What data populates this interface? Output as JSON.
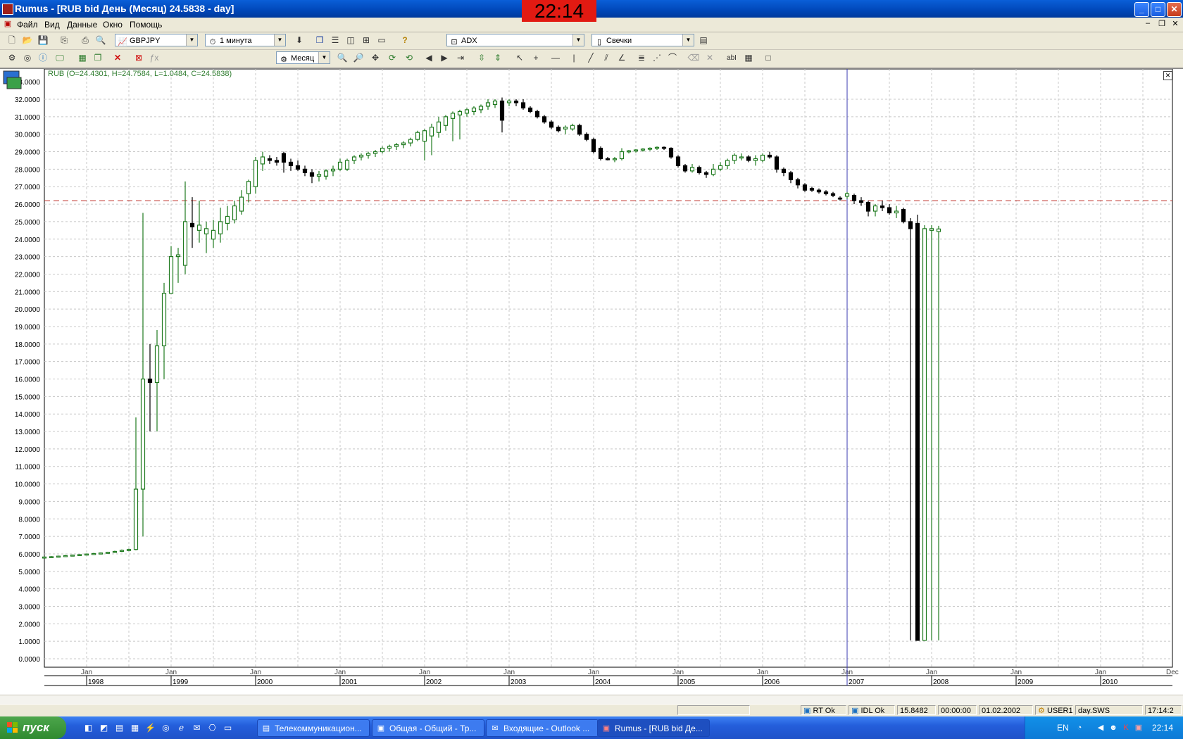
{
  "window": {
    "title": "Rumus - [RUB bid День (Месяц) 24.5838 - day]",
    "clock": "22:14",
    "buttons": {
      "minimize": "_",
      "maximize": "□",
      "close": "✕"
    }
  },
  "menu": {
    "items": [
      "Файл",
      "Вид",
      "Данные",
      "Окно",
      "Помощь"
    ],
    "mdi_buttons": [
      "–",
      "❐",
      "✕"
    ]
  },
  "toolbar1": {
    "symbol_combo": "GBPJPY",
    "interval_combo": "1 минута",
    "indicator_combo": "ADX",
    "chart_type_combo": "Свечки"
  },
  "toolbar2": {
    "period_combo": "Месяц",
    "text_tool": "abI"
  },
  "chart": {
    "ohlc_label": "RUB (O=24.4301, H=24.7584, L=1.0484, C=24.5838)",
    "colors": {
      "up": "#1f7a1f",
      "down": "#000000",
      "grid": "#c8c8c8",
      "hline": "#c0302a",
      "vline": "#3a3ab0"
    },
    "y_labels": [
      "32.0000",
      "31.0000",
      "30.0000",
      "29.0000",
      "28.0000",
      "27.0000",
      "26.0000",
      "25.0000",
      "24.0000",
      "23.0000",
      "22.0000",
      "21.0000",
      "20.0000",
      "19.0000",
      "18.0000",
      "17.0000",
      "16.0000",
      "15.0000",
      "14.0000",
      "13.0000",
      "12.0000",
      "11.0000",
      "10.0000",
      "9.0000",
      "8.0000",
      "7.0000",
      "6.0000",
      "5.0000",
      "4.0000",
      "3.0000",
      "2.0000",
      "1.0000",
      "0.0000"
    ],
    "y_top_label": "33.0000",
    "x_month_label": "Jan",
    "x_years": [
      "1998",
      "1999",
      "2000",
      "2001",
      "2002",
      "2003",
      "2004",
      "2005",
      "2006",
      "2007",
      "2008",
      "2009",
      "2010"
    ],
    "x_end_label": "Dec"
  },
  "chart_data": {
    "type": "candlestick",
    "title": "RUB bid День (Месяц)",
    "ylim": [
      0,
      33
    ],
    "x_range": [
      "1997-07",
      "2011-01"
    ],
    "hline": 26.2,
    "vline": "2007-01",
    "series": [
      {
        "t": "1997-07",
        "o": 5.8,
        "h": 5.85,
        "l": 5.75,
        "c": 5.82
      },
      {
        "t": "1997-08",
        "o": 5.82,
        "h": 5.87,
        "l": 5.78,
        "c": 5.84
      },
      {
        "t": "1997-09",
        "o": 5.84,
        "h": 5.9,
        "l": 5.8,
        "c": 5.87
      },
      {
        "t": "1997-10",
        "o": 5.87,
        "h": 5.93,
        "l": 5.83,
        "c": 5.9
      },
      {
        "t": "1997-11",
        "o": 5.9,
        "h": 5.96,
        "l": 5.86,
        "c": 5.93
      },
      {
        "t": "1997-12",
        "o": 5.93,
        "h": 5.99,
        "l": 5.89,
        "c": 5.96
      },
      {
        "t": "1998-01",
        "o": 5.96,
        "h": 6.02,
        "l": 5.92,
        "c": 5.99
      },
      {
        "t": "1998-02",
        "o": 5.99,
        "h": 6.05,
        "l": 5.95,
        "c": 6.02
      },
      {
        "t": "1998-03",
        "o": 6.02,
        "h": 6.08,
        "l": 5.98,
        "c": 6.05
      },
      {
        "t": "1998-04",
        "o": 6.05,
        "h": 6.12,
        "l": 6.01,
        "c": 6.09
      },
      {
        "t": "1998-05",
        "o": 6.09,
        "h": 6.18,
        "l": 6.05,
        "c": 6.14
      },
      {
        "t": "1998-06",
        "o": 6.14,
        "h": 6.25,
        "l": 6.1,
        "c": 6.2
      },
      {
        "t": "1998-07",
        "o": 6.2,
        "h": 6.3,
        "l": 6.15,
        "c": 6.25
      },
      {
        "t": "1998-08",
        "o": 6.25,
        "h": 13.8,
        "l": 6.2,
        "c": 9.7
      },
      {
        "t": "1998-09",
        "o": 9.7,
        "h": 25.5,
        "l": 7.0,
        "c": 16.0
      },
      {
        "t": "1998-10",
        "o": 16.0,
        "h": 18.0,
        "l": 13.0,
        "c": 15.8
      },
      {
        "t": "1998-11",
        "o": 15.8,
        "h": 18.8,
        "l": 13.0,
        "c": 17.9
      },
      {
        "t": "1998-12",
        "o": 17.9,
        "h": 21.5,
        "l": 16.0,
        "c": 20.9
      },
      {
        "t": "1999-01",
        "o": 20.9,
        "h": 23.6,
        "l": 21.0,
        "c": 23.0
      },
      {
        "t": "1999-02",
        "o": 23.0,
        "h": 23.5,
        "l": 21.5,
        "c": 23.1
      },
      {
        "t": "1999-03",
        "o": 22.5,
        "h": 27.3,
        "l": 22.0,
        "c": 25.0
      },
      {
        "t": "1999-04",
        "o": 24.9,
        "h": 26.4,
        "l": 23.5,
        "c": 24.7
      },
      {
        "t": "1999-05",
        "o": 24.5,
        "h": 26.2,
        "l": 23.8,
        "c": 24.8
      },
      {
        "t": "1999-06",
        "o": 24.3,
        "h": 25.0,
        "l": 23.2,
        "c": 24.6
      },
      {
        "t": "1999-07",
        "o": 24.0,
        "h": 25.1,
        "l": 23.5,
        "c": 24.5
      },
      {
        "t": "1999-08",
        "o": 24.3,
        "h": 25.8,
        "l": 23.8,
        "c": 25.0
      },
      {
        "t": "1999-09",
        "o": 24.9,
        "h": 25.9,
        "l": 24.5,
        "c": 25.3
      },
      {
        "t": "1999-10",
        "o": 25.1,
        "h": 26.2,
        "l": 24.9,
        "c": 25.9
      },
      {
        "t": "1999-11",
        "o": 25.6,
        "h": 26.8,
        "l": 25.4,
        "c": 26.4
      },
      {
        "t": "1999-12",
        "o": 26.6,
        "h": 27.4,
        "l": 26.1,
        "c": 27.3
      },
      {
        "t": "2000-01",
        "o": 27.0,
        "h": 28.7,
        "l": 26.6,
        "c": 28.5
      },
      {
        "t": "2000-02",
        "o": 28.3,
        "h": 29.0,
        "l": 27.9,
        "c": 28.7
      },
      {
        "t": "2000-03",
        "o": 28.6,
        "h": 28.8,
        "l": 28.3,
        "c": 28.5
      },
      {
        "t": "2000-04",
        "o": 28.5,
        "h": 28.7,
        "l": 28.2,
        "c": 28.4
      },
      {
        "t": "2000-05",
        "o": 28.9,
        "h": 29.0,
        "l": 27.8,
        "c": 28.4
      },
      {
        "t": "2000-06",
        "o": 28.4,
        "h": 28.6,
        "l": 27.9,
        "c": 28.2
      },
      {
        "t": "2000-07",
        "o": 28.2,
        "h": 28.5,
        "l": 27.9,
        "c": 28.0
      },
      {
        "t": "2000-08",
        "o": 28.0,
        "h": 28.2,
        "l": 27.6,
        "c": 27.8
      },
      {
        "t": "2000-09",
        "o": 27.8,
        "h": 28.0,
        "l": 27.2,
        "c": 27.6
      },
      {
        "t": "2000-10",
        "o": 27.6,
        "h": 27.9,
        "l": 27.3,
        "c": 27.7
      },
      {
        "t": "2000-11",
        "o": 27.6,
        "h": 28.0,
        "l": 27.4,
        "c": 27.9
      },
      {
        "t": "2000-12",
        "o": 27.9,
        "h": 28.2,
        "l": 27.6,
        "c": 28.0
      },
      {
        "t": "2001-01",
        "o": 28.0,
        "h": 28.6,
        "l": 27.9,
        "c": 28.4
      },
      {
        "t": "2001-02",
        "o": 28.0,
        "h": 28.6,
        "l": 27.9,
        "c": 28.5
      },
      {
        "t": "2001-03",
        "o": 28.5,
        "h": 28.8,
        "l": 28.3,
        "c": 28.7
      },
      {
        "t": "2001-04",
        "o": 28.7,
        "h": 28.9,
        "l": 28.5,
        "c": 28.8
      },
      {
        "t": "2001-05",
        "o": 28.8,
        "h": 29.0,
        "l": 28.6,
        "c": 28.9
      },
      {
        "t": "2001-06",
        "o": 28.9,
        "h": 29.1,
        "l": 28.7,
        "c": 29.0
      },
      {
        "t": "2001-07",
        "o": 29.0,
        "h": 29.3,
        "l": 28.9,
        "c": 29.2
      },
      {
        "t": "2001-08",
        "o": 29.2,
        "h": 29.4,
        "l": 29.0,
        "c": 29.3
      },
      {
        "t": "2001-09",
        "o": 29.3,
        "h": 29.5,
        "l": 29.1,
        "c": 29.4
      },
      {
        "t": "2001-10",
        "o": 29.4,
        "h": 29.6,
        "l": 29.2,
        "c": 29.5
      },
      {
        "t": "2001-11",
        "o": 29.5,
        "h": 29.8,
        "l": 29.3,
        "c": 29.7
      },
      {
        "t": "2001-12",
        "o": 29.7,
        "h": 30.2,
        "l": 29.6,
        "c": 30.1
      },
      {
        "t": "2002-01",
        "o": 29.6,
        "h": 30.3,
        "l": 28.5,
        "c": 30.2
      },
      {
        "t": "2002-02",
        "o": 29.9,
        "h": 30.6,
        "l": 28.8,
        "c": 30.4
      },
      {
        "t": "2002-03",
        "o": 30.1,
        "h": 31.0,
        "l": 29.8,
        "c": 30.7
      },
      {
        "t": "2002-04",
        "o": 30.5,
        "h": 31.1,
        "l": 30.2,
        "c": 31.0
      },
      {
        "t": "2002-05",
        "o": 30.9,
        "h": 31.3,
        "l": 29.6,
        "c": 31.2
      },
      {
        "t": "2002-06",
        "o": 31.1,
        "h": 31.4,
        "l": 29.7,
        "c": 31.3
      },
      {
        "t": "2002-07",
        "o": 31.2,
        "h": 31.5,
        "l": 31.0,
        "c": 31.4
      },
      {
        "t": "2002-08",
        "o": 31.3,
        "h": 31.6,
        "l": 31.1,
        "c": 31.5
      },
      {
        "t": "2002-09",
        "o": 31.4,
        "h": 31.7,
        "l": 31.2,
        "c": 31.6
      },
      {
        "t": "2002-10",
        "o": 31.6,
        "h": 32.0,
        "l": 31.4,
        "c": 31.8
      },
      {
        "t": "2002-11",
        "o": 31.7,
        "h": 32.0,
        "l": 31.5,
        "c": 31.9
      },
      {
        "t": "2002-12",
        "o": 31.9,
        "h": 32.1,
        "l": 30.1,
        "c": 30.8
      },
      {
        "t": "2003-01",
        "o": 31.8,
        "h": 32.0,
        "l": 31.6,
        "c": 31.9
      },
      {
        "t": "2003-02",
        "o": 31.9,
        "h": 32.0,
        "l": 31.6,
        "c": 31.8
      },
      {
        "t": "2003-03",
        "o": 31.8,
        "h": 32.0,
        "l": 31.4,
        "c": 31.5
      },
      {
        "t": "2003-04",
        "o": 31.5,
        "h": 31.6,
        "l": 31.2,
        "c": 31.3
      },
      {
        "t": "2003-05",
        "o": 31.3,
        "h": 31.4,
        "l": 30.9,
        "c": 31.0
      },
      {
        "t": "2003-06",
        "o": 31.0,
        "h": 31.1,
        "l": 30.6,
        "c": 30.7
      },
      {
        "t": "2003-07",
        "o": 30.7,
        "h": 30.8,
        "l": 30.3,
        "c": 30.4
      },
      {
        "t": "2003-08",
        "o": 30.4,
        "h": 30.5,
        "l": 30.1,
        "c": 30.2
      },
      {
        "t": "2003-09",
        "o": 30.3,
        "h": 30.5,
        "l": 30.0,
        "c": 30.4
      },
      {
        "t": "2003-10",
        "o": 30.3,
        "h": 30.6,
        "l": 30.2,
        "c": 30.5
      },
      {
        "t": "2003-11",
        "o": 30.5,
        "h": 30.6,
        "l": 29.9,
        "c": 30.0
      },
      {
        "t": "2003-12",
        "o": 30.0,
        "h": 30.1,
        "l": 29.6,
        "c": 29.7
      },
      {
        "t": "2004-01",
        "o": 29.7,
        "h": 29.8,
        "l": 28.9,
        "c": 29.0
      },
      {
        "t": "2004-02",
        "o": 29.2,
        "h": 29.3,
        "l": 28.5,
        "c": 28.6
      },
      {
        "t": "2004-03",
        "o": 28.6,
        "h": 28.7,
        "l": 28.5,
        "c": 28.55
      },
      {
        "t": "2004-04",
        "o": 28.55,
        "h": 28.7,
        "l": 28.4,
        "c": 28.6
      },
      {
        "t": "2004-05",
        "o": 28.6,
        "h": 29.2,
        "l": 28.5,
        "c": 29.0
      },
      {
        "t": "2004-06",
        "o": 29.0,
        "h": 29.1,
        "l": 28.9,
        "c": 29.05
      },
      {
        "t": "2004-07",
        "o": 29.05,
        "h": 29.15,
        "l": 28.95,
        "c": 29.1
      },
      {
        "t": "2004-08",
        "o": 29.1,
        "h": 29.2,
        "l": 29.0,
        "c": 29.15
      },
      {
        "t": "2004-09",
        "o": 29.15,
        "h": 29.25,
        "l": 29.05,
        "c": 29.2
      },
      {
        "t": "2004-10",
        "o": 29.2,
        "h": 29.3,
        "l": 29.1,
        "c": 29.25
      },
      {
        "t": "2004-11",
        "o": 29.25,
        "h": 29.3,
        "l": 29.1,
        "c": 29.2
      },
      {
        "t": "2004-12",
        "o": 29.2,
        "h": 29.25,
        "l": 28.6,
        "c": 28.7
      },
      {
        "t": "2005-01",
        "o": 28.7,
        "h": 28.8,
        "l": 28.1,
        "c": 28.2
      },
      {
        "t": "2005-02",
        "o": 28.2,
        "h": 28.3,
        "l": 27.8,
        "c": 27.9
      },
      {
        "t": "2005-03",
        "o": 27.9,
        "h": 28.3,
        "l": 27.8,
        "c": 28.1
      },
      {
        "t": "2005-04",
        "o": 28.1,
        "h": 28.2,
        "l": 27.7,
        "c": 27.8
      },
      {
        "t": "2005-05",
        "o": 27.8,
        "h": 27.9,
        "l": 27.5,
        "c": 27.7
      },
      {
        "t": "2005-06",
        "o": 27.7,
        "h": 28.3,
        "l": 27.6,
        "c": 28.0
      },
      {
        "t": "2005-07",
        "o": 28.0,
        "h": 28.4,
        "l": 27.9,
        "c": 28.2
      },
      {
        "t": "2005-08",
        "o": 28.2,
        "h": 28.6,
        "l": 28.0,
        "c": 28.5
      },
      {
        "t": "2005-09",
        "o": 28.5,
        "h": 28.9,
        "l": 28.3,
        "c": 28.8
      },
      {
        "t": "2005-10",
        "o": 28.7,
        "h": 28.9,
        "l": 28.5,
        "c": 28.7
      },
      {
        "t": "2005-11",
        "o": 28.7,
        "h": 28.8,
        "l": 28.4,
        "c": 28.5
      },
      {
        "t": "2005-12",
        "o": 28.5,
        "h": 28.8,
        "l": 28.2,
        "c": 28.6
      },
      {
        "t": "2006-01",
        "o": 28.5,
        "h": 28.9,
        "l": 28.4,
        "c": 28.8
      },
      {
        "t": "2006-02",
        "o": 28.8,
        "h": 29.0,
        "l": 28.6,
        "c": 28.7
      },
      {
        "t": "2006-03",
        "o": 28.7,
        "h": 28.8,
        "l": 27.8,
        "c": 28.0
      },
      {
        "t": "2006-04",
        "o": 28.0,
        "h": 28.1,
        "l": 27.6,
        "c": 27.8
      },
      {
        "t": "2006-05",
        "o": 27.8,
        "h": 27.9,
        "l": 27.2,
        "c": 27.4
      },
      {
        "t": "2006-06",
        "o": 27.4,
        "h": 27.5,
        "l": 26.9,
        "c": 27.1
      },
      {
        "t": "2006-07",
        "o": 27.1,
        "h": 27.2,
        "l": 26.7,
        "c": 26.8
      },
      {
        "t": "2006-08",
        "o": 26.9,
        "h": 27.0,
        "l": 26.7,
        "c": 26.8
      },
      {
        "t": "2006-09",
        "o": 26.8,
        "h": 26.9,
        "l": 26.6,
        "c": 26.7
      },
      {
        "t": "2006-10",
        "o": 26.7,
        "h": 26.8,
        "l": 26.5,
        "c": 26.6
      },
      {
        "t": "2006-11",
        "o": 26.6,
        "h": 26.7,
        "l": 26.4,
        "c": 26.5
      },
      {
        "t": "2006-12",
        "o": 26.35,
        "h": 26.45,
        "l": 26.2,
        "c": 26.3
      },
      {
        "t": "2007-01",
        "o": 26.45,
        "h": 26.7,
        "l": 26.3,
        "c": 26.6
      },
      {
        "t": "2007-02",
        "o": 26.5,
        "h": 26.6,
        "l": 26.0,
        "c": 26.2
      },
      {
        "t": "2007-03",
        "o": 26.2,
        "h": 26.4,
        "l": 25.9,
        "c": 26.1
      },
      {
        "t": "2007-04",
        "o": 26.1,
        "h": 26.2,
        "l": 25.3,
        "c": 25.6
      },
      {
        "t": "2007-05",
        "o": 25.6,
        "h": 26.0,
        "l": 25.3,
        "c": 25.9
      },
      {
        "t": "2007-06",
        "o": 25.9,
        "h": 26.2,
        "l": 25.6,
        "c": 25.8
      },
      {
        "t": "2007-07",
        "o": 25.8,
        "h": 26.0,
        "l": 25.4,
        "c": 25.5
      },
      {
        "t": "2007-08",
        "o": 25.5,
        "h": 25.9,
        "l": 25.2,
        "c": 25.6
      },
      {
        "t": "2007-09",
        "o": 25.7,
        "h": 25.8,
        "l": 24.9,
        "c": 25.0
      },
      {
        "t": "2007-10",
        "o": 25.0,
        "h": 25.2,
        "l": 1.05,
        "c": 24.6
      },
      {
        "t": "2007-11",
        "o": 24.9,
        "h": 25.4,
        "l": 1.05,
        "c": 1.05
      },
      {
        "t": "2007-12",
        "o": 1.05,
        "h": 24.8,
        "l": 1.05,
        "c": 24.6
      },
      {
        "t": "2008-01",
        "o": 24.5,
        "h": 24.8,
        "l": 1.05,
        "c": 24.6
      },
      {
        "t": "2008-02",
        "o": 24.43,
        "h": 24.76,
        "l": 1.05,
        "c": 24.58
      }
    ]
  },
  "statusbar": {
    "cells": [
      "RT Ok",
      "IDL Ok",
      "15.8482",
      "00:00:00",
      "01.02.2002",
      "USER1",
      "day.SWS",
      "17:14:2"
    ]
  },
  "taskbar": {
    "start_label": "пуск",
    "tasks": [
      "Телекоммуникацион...",
      "Общая - Общий - Тр...",
      "Входящие - Outlook ...",
      "Rumus - [RUB bid Де..."
    ],
    "lang": "EN",
    "time": "22:14"
  }
}
